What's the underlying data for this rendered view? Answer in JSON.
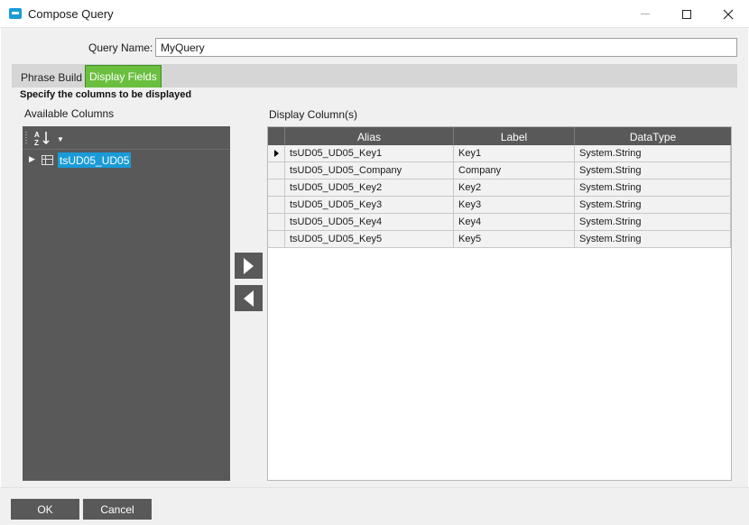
{
  "window": {
    "title": "Compose Query",
    "icon": "app-window-icon"
  },
  "query": {
    "name_label": "Query Name:",
    "name_value": "MyQuery"
  },
  "tabs": [
    {
      "label": "Phrase Build",
      "active": false
    },
    {
      "label": "Display Fields",
      "active": true
    }
  ],
  "panel": {
    "hint": "Specify the columns to be displayed",
    "available_label": "Available Columns",
    "display_label": "Display Column(s)"
  },
  "tree": {
    "sort_icon": "sort-az-icon",
    "nodes": [
      {
        "label": "tsUD05_UD05",
        "selected": true,
        "icon": "table-icon"
      }
    ]
  },
  "grid": {
    "columns": [
      "Alias",
      "Label",
      "DataType"
    ],
    "rows": [
      {
        "alias": "tsUD05_UD05_Key1",
        "label": "Key1",
        "type": "System.String",
        "current": true
      },
      {
        "alias": "tsUD05_UD05_Company",
        "label": "Company",
        "type": "System.String",
        "current": false
      },
      {
        "alias": "tsUD05_UD05_Key2",
        "label": "Key2",
        "type": "System.String",
        "current": false
      },
      {
        "alias": "tsUD05_UD05_Key3",
        "label": "Key3",
        "type": "System.String",
        "current": false
      },
      {
        "alias": "tsUD05_UD05_Key4",
        "label": "Key4",
        "type": "System.String",
        "current": false
      },
      {
        "alias": "tsUD05_UD05_Key5",
        "label": "Key5",
        "type": "System.String",
        "current": false
      }
    ]
  },
  "buttons": {
    "ok": "OK",
    "cancel": "Cancel"
  },
  "colors": {
    "accent": "#1a9bd7",
    "active_tab": "#6abf3f",
    "dark_panel": "#595959"
  }
}
